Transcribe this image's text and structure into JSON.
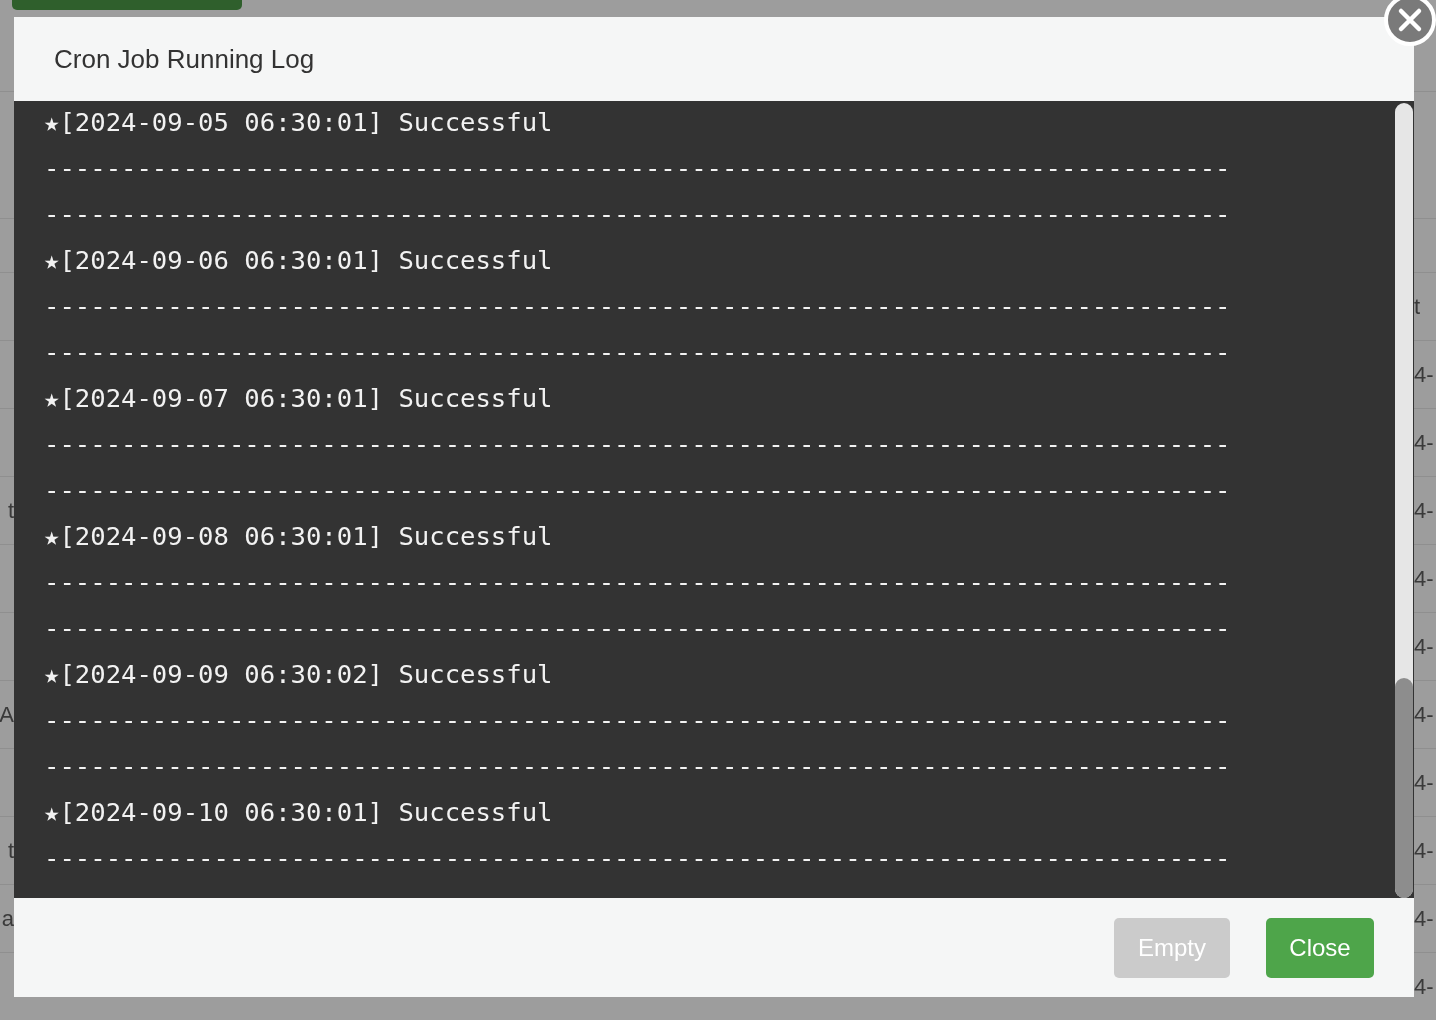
{
  "background": {
    "rows": [
      {
        "column_last": "t"
      },
      {
        "column_last": "4-"
      },
      {
        "column_last": "4-"
      },
      {
        "column_1": "t",
        "column_last": "4-"
      },
      {
        "column_last": "4-"
      },
      {
        "column_last": "4-"
      },
      {
        "column_1": "A",
        "column_last": "4-"
      },
      {
        "column_last": "4-"
      },
      {
        "column_1": "t",
        "column_last": "4-"
      },
      {
        "column_1": "a",
        "column_last": "4-"
      },
      {
        "column_last": "4-"
      }
    ]
  },
  "dialog": {
    "title": "Cron Job Running Log",
    "log": {
      "entries": [
        {
          "marker": "★",
          "time": "[2024-09-05 06:30:01]",
          "status": "Successful",
          "separators": [
            "-----------------------------------------------------------------------------",
            "-----------------------------------------------------------------------------"
          ]
        },
        {
          "marker": "★",
          "time": "[2024-09-06 06:30:01]",
          "status": "Successful",
          "separators": [
            "-----------------------------------------------------------------------------",
            "-----------------------------------------------------------------------------"
          ]
        },
        {
          "marker": "★",
          "time": "[2024-09-07 06:30:01]",
          "status": "Successful",
          "separators": [
            "-----------------------------------------------------------------------------",
            "-----------------------------------------------------------------------------"
          ]
        },
        {
          "marker": "★",
          "time": "[2024-09-08 06:30:01]",
          "status": "Successful",
          "separators": [
            "-----------------------------------------------------------------------------",
            "-----------------------------------------------------------------------------"
          ]
        },
        {
          "marker": "★",
          "time": "[2024-09-09 06:30:02]",
          "status": "Successful",
          "separators": [
            "-----------------------------------------------------------------------------",
            "-----------------------------------------------------------------------------"
          ]
        },
        {
          "marker": "★",
          "time": "[2024-09-10 06:30:01]",
          "status": "Successful",
          "separators": [
            "-----------------------------------------------------------------------------"
          ]
        }
      ]
    },
    "buttons": [
      {
        "label": "Empty",
        "disabled": true
      },
      {
        "label": "Close",
        "disabled": false
      }
    ]
  }
}
